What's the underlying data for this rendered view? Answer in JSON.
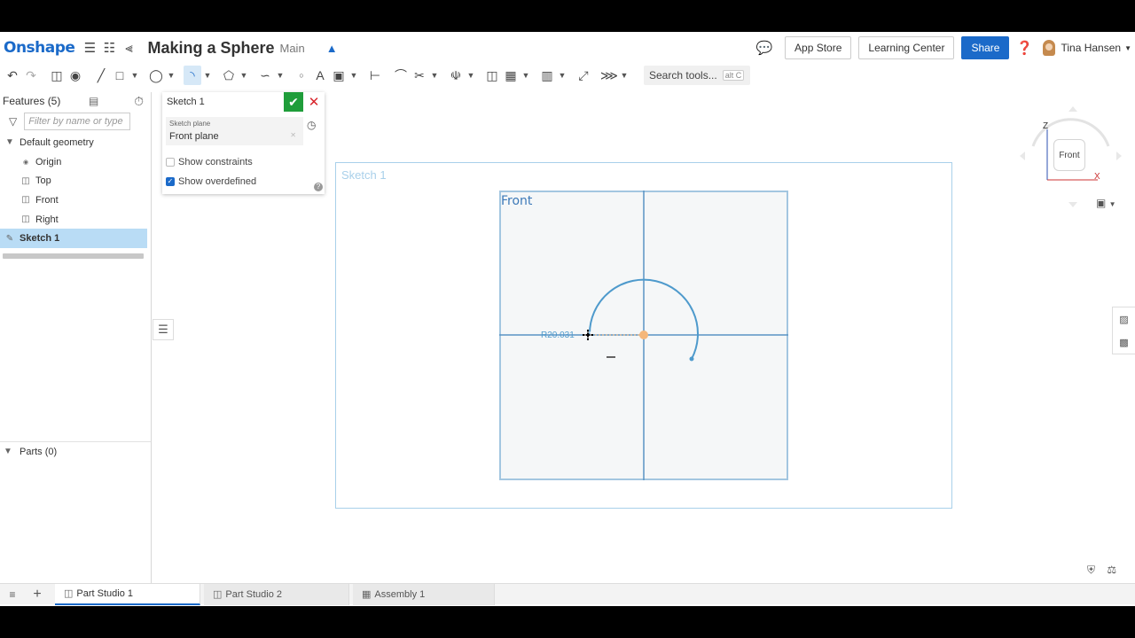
{
  "header": {
    "logo": "Onshape",
    "doc_title": "Making a Sphere",
    "branch": "Main",
    "app_store": "App Store",
    "learning_center": "Learning Center",
    "share": "Share",
    "user_name": "Tina Hansen"
  },
  "toolbar": {
    "search_label": "Search tools...",
    "search_shortcut": "alt C"
  },
  "features": {
    "title": "Features (5)",
    "filter_placeholder": "Filter by name or type",
    "default_geometry": "Default geometry",
    "items": [
      "Origin",
      "Top",
      "Front",
      "Right"
    ],
    "sketch": "Sketch 1"
  },
  "parts": {
    "title": "Parts (0)"
  },
  "dialog": {
    "title": "Sketch 1",
    "plane_label": "Sketch plane",
    "plane_value": "Front plane",
    "show_constraints": "Show constraints",
    "show_constraints_checked": false,
    "show_overdefined": "Show overdefined",
    "show_overdefined_checked": true
  },
  "viewport": {
    "sketch_label": "Sketch 1",
    "plane_label": "Front",
    "dimension_text": "R20.031",
    "arc_color": "#4e9acc",
    "origin_color": "#f5b77a"
  },
  "navcube": {
    "face": "Front",
    "axis_z": "Z",
    "axis_x": "X"
  },
  "tabs": [
    "Part Studio 1",
    "Part Studio 2",
    "Assembly 1"
  ],
  "colors": {
    "accent": "#1b6ac9",
    "confirm": "#1f9d3a",
    "cancel": "#d8242b"
  }
}
